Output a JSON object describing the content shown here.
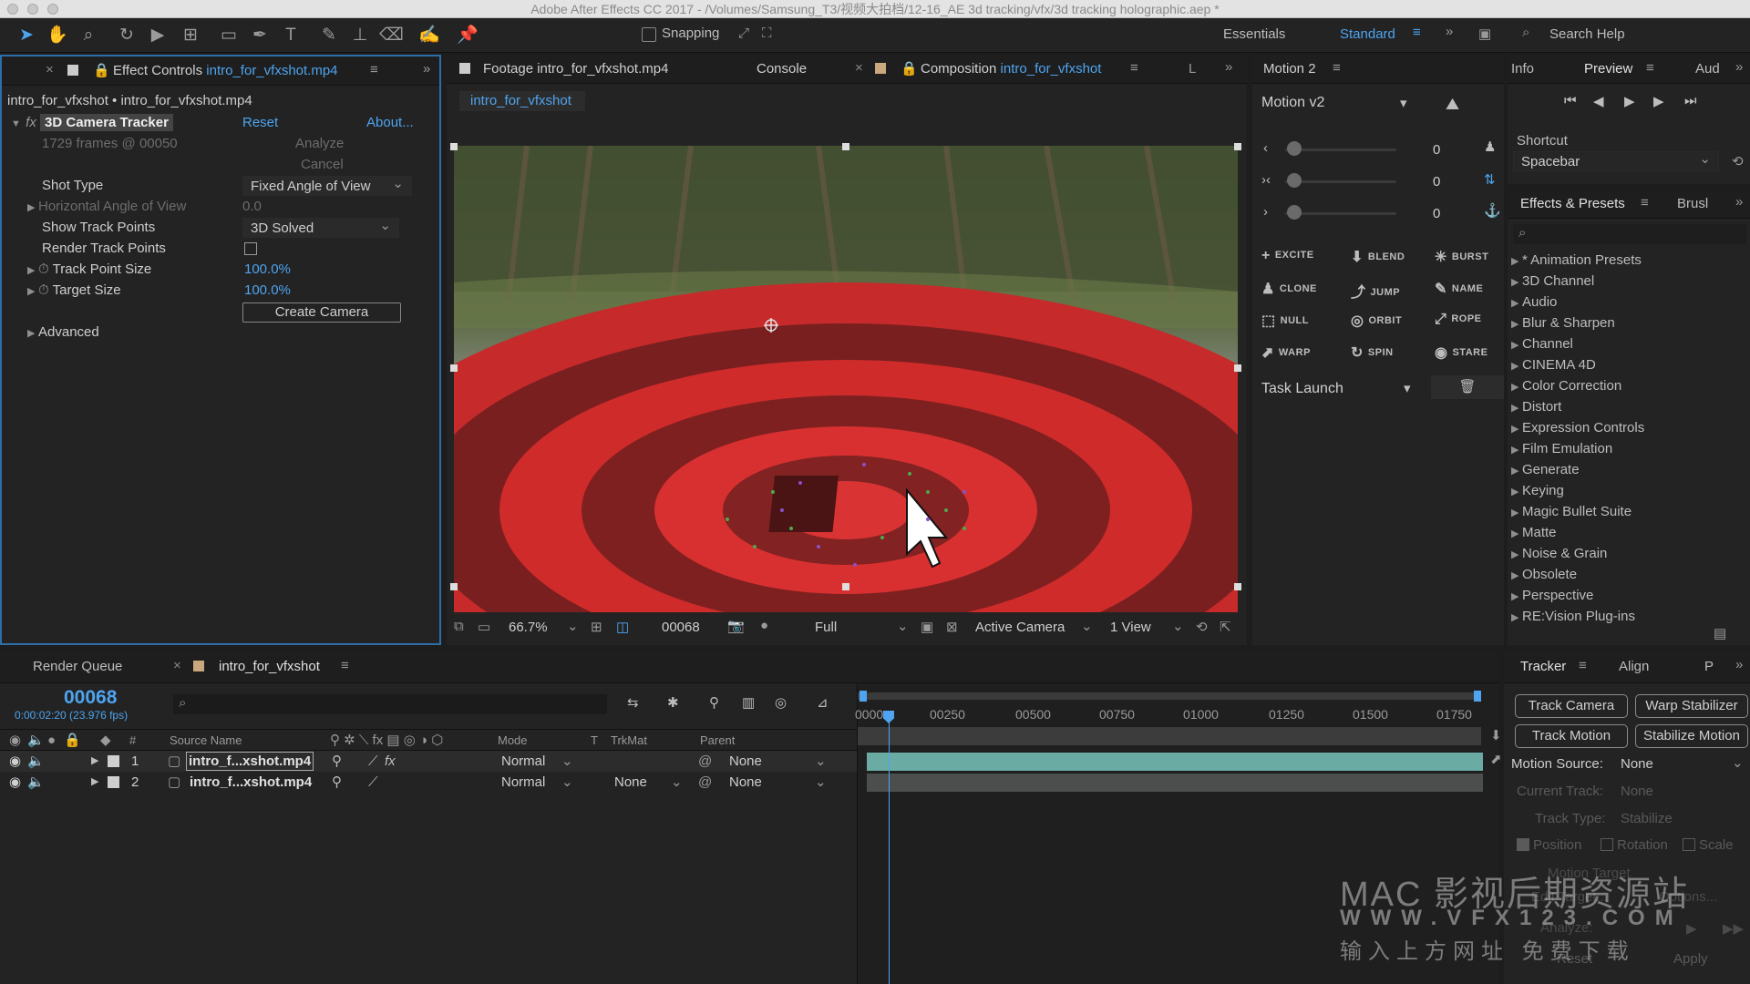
{
  "app": {
    "title": "Adobe After Effects CC 2017 - /Volumes/Samsung_T3/视频大拍档/12-16_AE 3d tracking/vfx/3d tracking holographic.aep *"
  },
  "toolbar": {
    "snapping_label": "Snapping",
    "workspaces": [
      "Essentials",
      "Standard"
    ],
    "search_placeholder": "Search Help"
  },
  "effect_controls": {
    "tab_prefix": "Effect Controls",
    "tab_file": "intro_for_vfxshot.mp4",
    "breadcrumb": "intro_for_vfxshot • intro_for_vfxshot.mp4",
    "effect_name": "3D Camera Tracker",
    "reset": "Reset",
    "about": "About...",
    "frames_info": "1729 frames @ 00050",
    "analyze": "Analyze",
    "cancel": "Cancel",
    "props": {
      "shot_type_label": "Shot Type",
      "shot_type_value": "Fixed Angle of View",
      "h_angle_label": "Horizontal Angle of View",
      "h_angle_value": "0.0",
      "show_track_label": "Show Track Points",
      "show_track_value": "3D Solved",
      "render_track_label": "Render Track Points",
      "point_size_label": "Track Point Size",
      "point_size_value": "100.0%",
      "target_size_label": "Target Size",
      "target_size_value": "100.0%",
      "create_camera": "Create Camera",
      "advanced": "Advanced"
    }
  },
  "viewer": {
    "footage_tab": "Footage intro_for_vfxshot.mp4",
    "console_tab": "Console",
    "comp_tab_prefix": "Composition",
    "comp_tab_name": "intro_for_vfxshot",
    "extra_tab": "L",
    "comp_subtab": "intro_for_vfxshot",
    "zoom": "66.7%",
    "timecode": "00068",
    "resolution": "Full",
    "camera": "Active Camera",
    "views": "1 View"
  },
  "motion": {
    "panel_title": "Motion 2",
    "version": "Motion v2",
    "slider_values": [
      "0",
      "0",
      "0"
    ],
    "buttons": [
      "EXCITE",
      "BLEND",
      "BURST",
      "CLONE",
      "JUMP",
      "NAME",
      "NULL",
      "ORBIT",
      "ROPE",
      "WARP",
      "SPIN",
      "STARE"
    ],
    "task_launch": "Task Launch"
  },
  "preview": {
    "tabs": [
      "Info",
      "Preview",
      "Aud"
    ],
    "shortcut_label": "Shortcut",
    "shortcut_value": "Spacebar"
  },
  "effects_presets": {
    "title": "Effects & Presets",
    "brush_tab": "Brusl",
    "items": [
      "* Animation Presets",
      "3D Channel",
      "Audio",
      "Blur & Sharpen",
      "Channel",
      "CINEMA 4D",
      "Color Correction",
      "Distort",
      "Expression Controls",
      "Film Emulation",
      "Generate",
      "Keying",
      "Magic Bullet Suite",
      "Matte",
      "Noise & Grain",
      "Obsolete",
      "Perspective",
      "RE:Vision Plug-ins"
    ]
  },
  "timeline": {
    "render_queue_tab": "Render Queue",
    "comp_tab": "intro_for_vfxshot",
    "current_time": "00068",
    "time_detail": "0:00:02:20 (23.976 fps)",
    "columns": {
      "hash": "#",
      "source": "Source Name",
      "mode": "Mode",
      "t": "T",
      "trkmat": "TrkMat",
      "parent": "Parent"
    },
    "layers": [
      {
        "num": "1",
        "name": "intro_f...xshot.mp4",
        "mode": "Normal",
        "trkmat": "",
        "parent": "None"
      },
      {
        "num": "2",
        "name": "intro_f...xshot.mp4",
        "mode": "Normal",
        "trkmat": "None",
        "parent": "None"
      }
    ],
    "ruler": [
      "0000",
      "00250",
      "00500",
      "00750",
      "01000",
      "01250",
      "01500",
      "01750"
    ]
  },
  "tracker": {
    "tabs": [
      "Tracker",
      "Align",
      "P"
    ],
    "buttons": [
      "Track Camera",
      "Warp Stabilizer",
      "Track Motion",
      "Stabilize Motion"
    ],
    "motion_source_label": "Motion Source:",
    "motion_source_value": "None",
    "current_track_label": "Current Track:",
    "current_track_value": "None",
    "track_type_label": "Track Type:",
    "track_type_value": "Stabilize",
    "checks": [
      "Position",
      "Rotation",
      "Scale"
    ],
    "motion_target": "Motion Target",
    "edit_target": "Edit Target...",
    "options": "Options...",
    "analyze": "Analyze:",
    "reset": "Reset",
    "apply": "Apply"
  },
  "watermark": {
    "line1": "MAC 影视后期资源站",
    "line2": "WWW.VFX123.COM",
    "line3": "输入上方网址 免费下载"
  }
}
